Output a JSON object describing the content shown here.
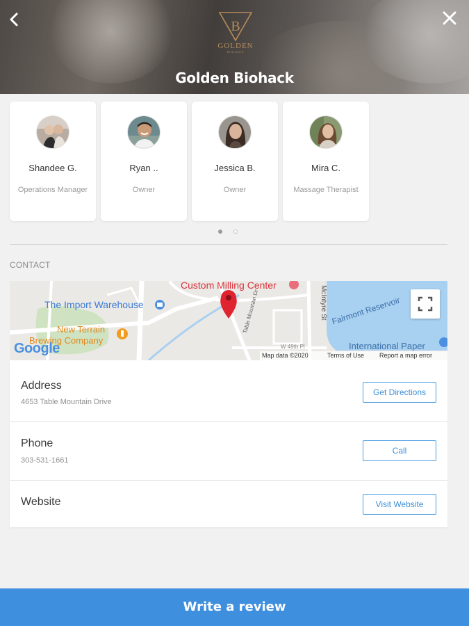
{
  "header": {
    "title": "Golden Biohack",
    "logo_text": "GOLDEN",
    "logo_subtext": "BIOHACK",
    "logo_letter": "B",
    "back_icon": "chevron-left-icon",
    "close_icon": "close-icon"
  },
  "team": {
    "members": [
      {
        "name": "Shandee G.",
        "role": "Operations Manager"
      },
      {
        "name": "Ryan ..",
        "role": "Owner"
      },
      {
        "name": "Jessica B.",
        "role": "Owner"
      },
      {
        "name": "Mira C.",
        "role": "Massage Therapist"
      }
    ],
    "pagination": {
      "pages": 2,
      "current": 1
    }
  },
  "contact": {
    "section_label": "CONTACT",
    "map": {
      "labels": {
        "custom_milling": "Custom Milling Center",
        "import_warehouse": "The Import Warehouse",
        "new_terrain_1": "New Terrain",
        "new_terrain_2": "Brewing Company",
        "fairmont": "Fairmont Reservoir",
        "intl_paper": "International Paper",
        "mcintyre": "McIntyre St",
        "table_mountain": "Table Mountain Dr",
        "w49th": "W 49th Pl",
        "google": "Google"
      },
      "footer": {
        "map_data": "Map data ©2020",
        "terms": "Terms of Use",
        "report": "Report a map error"
      }
    },
    "address": {
      "title": "Address",
      "value": "4653 Table Mountain Drive",
      "button": "Get Directions"
    },
    "phone": {
      "title": "Phone",
      "value": "303-531-1661",
      "button": "Call"
    },
    "website": {
      "title": "Website",
      "button": "Visit Website"
    }
  },
  "footer": {
    "review_button": "Write a review"
  },
  "colors": {
    "accent": "#3f8fdf",
    "pin": "#e0242f",
    "water": "#a8d0f0"
  }
}
